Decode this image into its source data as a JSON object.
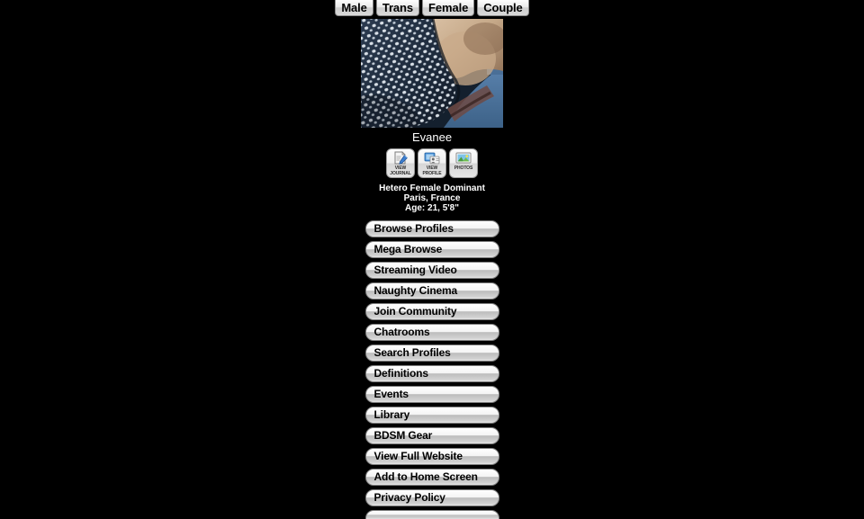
{
  "top_tabs": [
    {
      "label": "Male",
      "name": "tab-male"
    },
    {
      "label": "Trans",
      "name": "tab-trans"
    },
    {
      "label": "Female",
      "name": "tab-female"
    },
    {
      "label": "Couple",
      "name": "tab-couple"
    }
  ],
  "profile": {
    "name": "Evanee",
    "photo_alt": "profile-photo",
    "orientation_line": "Hetero Female Dominant",
    "location_line": "Paris, France",
    "age_line": "Age: 21, 5'8\""
  },
  "profile_actions": [
    {
      "caption_line1": "VIEW",
      "caption_line2": "JOURNAL",
      "icon": "journal-pen-icon",
      "name": "view-journal-button"
    },
    {
      "caption_line1": "VIEW",
      "caption_line2": "PROFILE",
      "icon": "profile-card-icon",
      "name": "view-profile-button"
    },
    {
      "caption_line1": "PHOTOS",
      "caption_line2": "",
      "icon": "photos-image-icon",
      "name": "photos-button"
    }
  ],
  "menu": [
    {
      "label": "Browse Profiles",
      "name": "menu-browse-profiles"
    },
    {
      "label": "Mega Browse",
      "name": "menu-mega-browse"
    },
    {
      "label": "Streaming Video",
      "name": "menu-streaming-video"
    },
    {
      "label": "Naughty Cinema",
      "name": "menu-naughty-cinema"
    },
    {
      "label": "Join Community",
      "name": "menu-join-community"
    },
    {
      "label": "Chatrooms",
      "name": "menu-chatrooms"
    },
    {
      "label": "Search Profiles",
      "name": "menu-search-profiles"
    },
    {
      "label": "Definitions",
      "name": "menu-definitions"
    },
    {
      "label": "Events",
      "name": "menu-events"
    },
    {
      "label": "Library",
      "name": "menu-library"
    },
    {
      "label": "BDSM Gear",
      "name": "menu-bdsm-gear"
    },
    {
      "label": "View Full Website",
      "name": "menu-view-full-website"
    },
    {
      "label": "Add to Home Screen",
      "name": "menu-add-to-home-screen"
    },
    {
      "label": "Privacy Policy",
      "name": "menu-privacy-policy"
    },
    {
      "label": "",
      "name": "menu-partially-visible"
    }
  ],
  "colors": {
    "background": "#000000",
    "button_text": "#000000",
    "page_text": "#ffffff"
  }
}
